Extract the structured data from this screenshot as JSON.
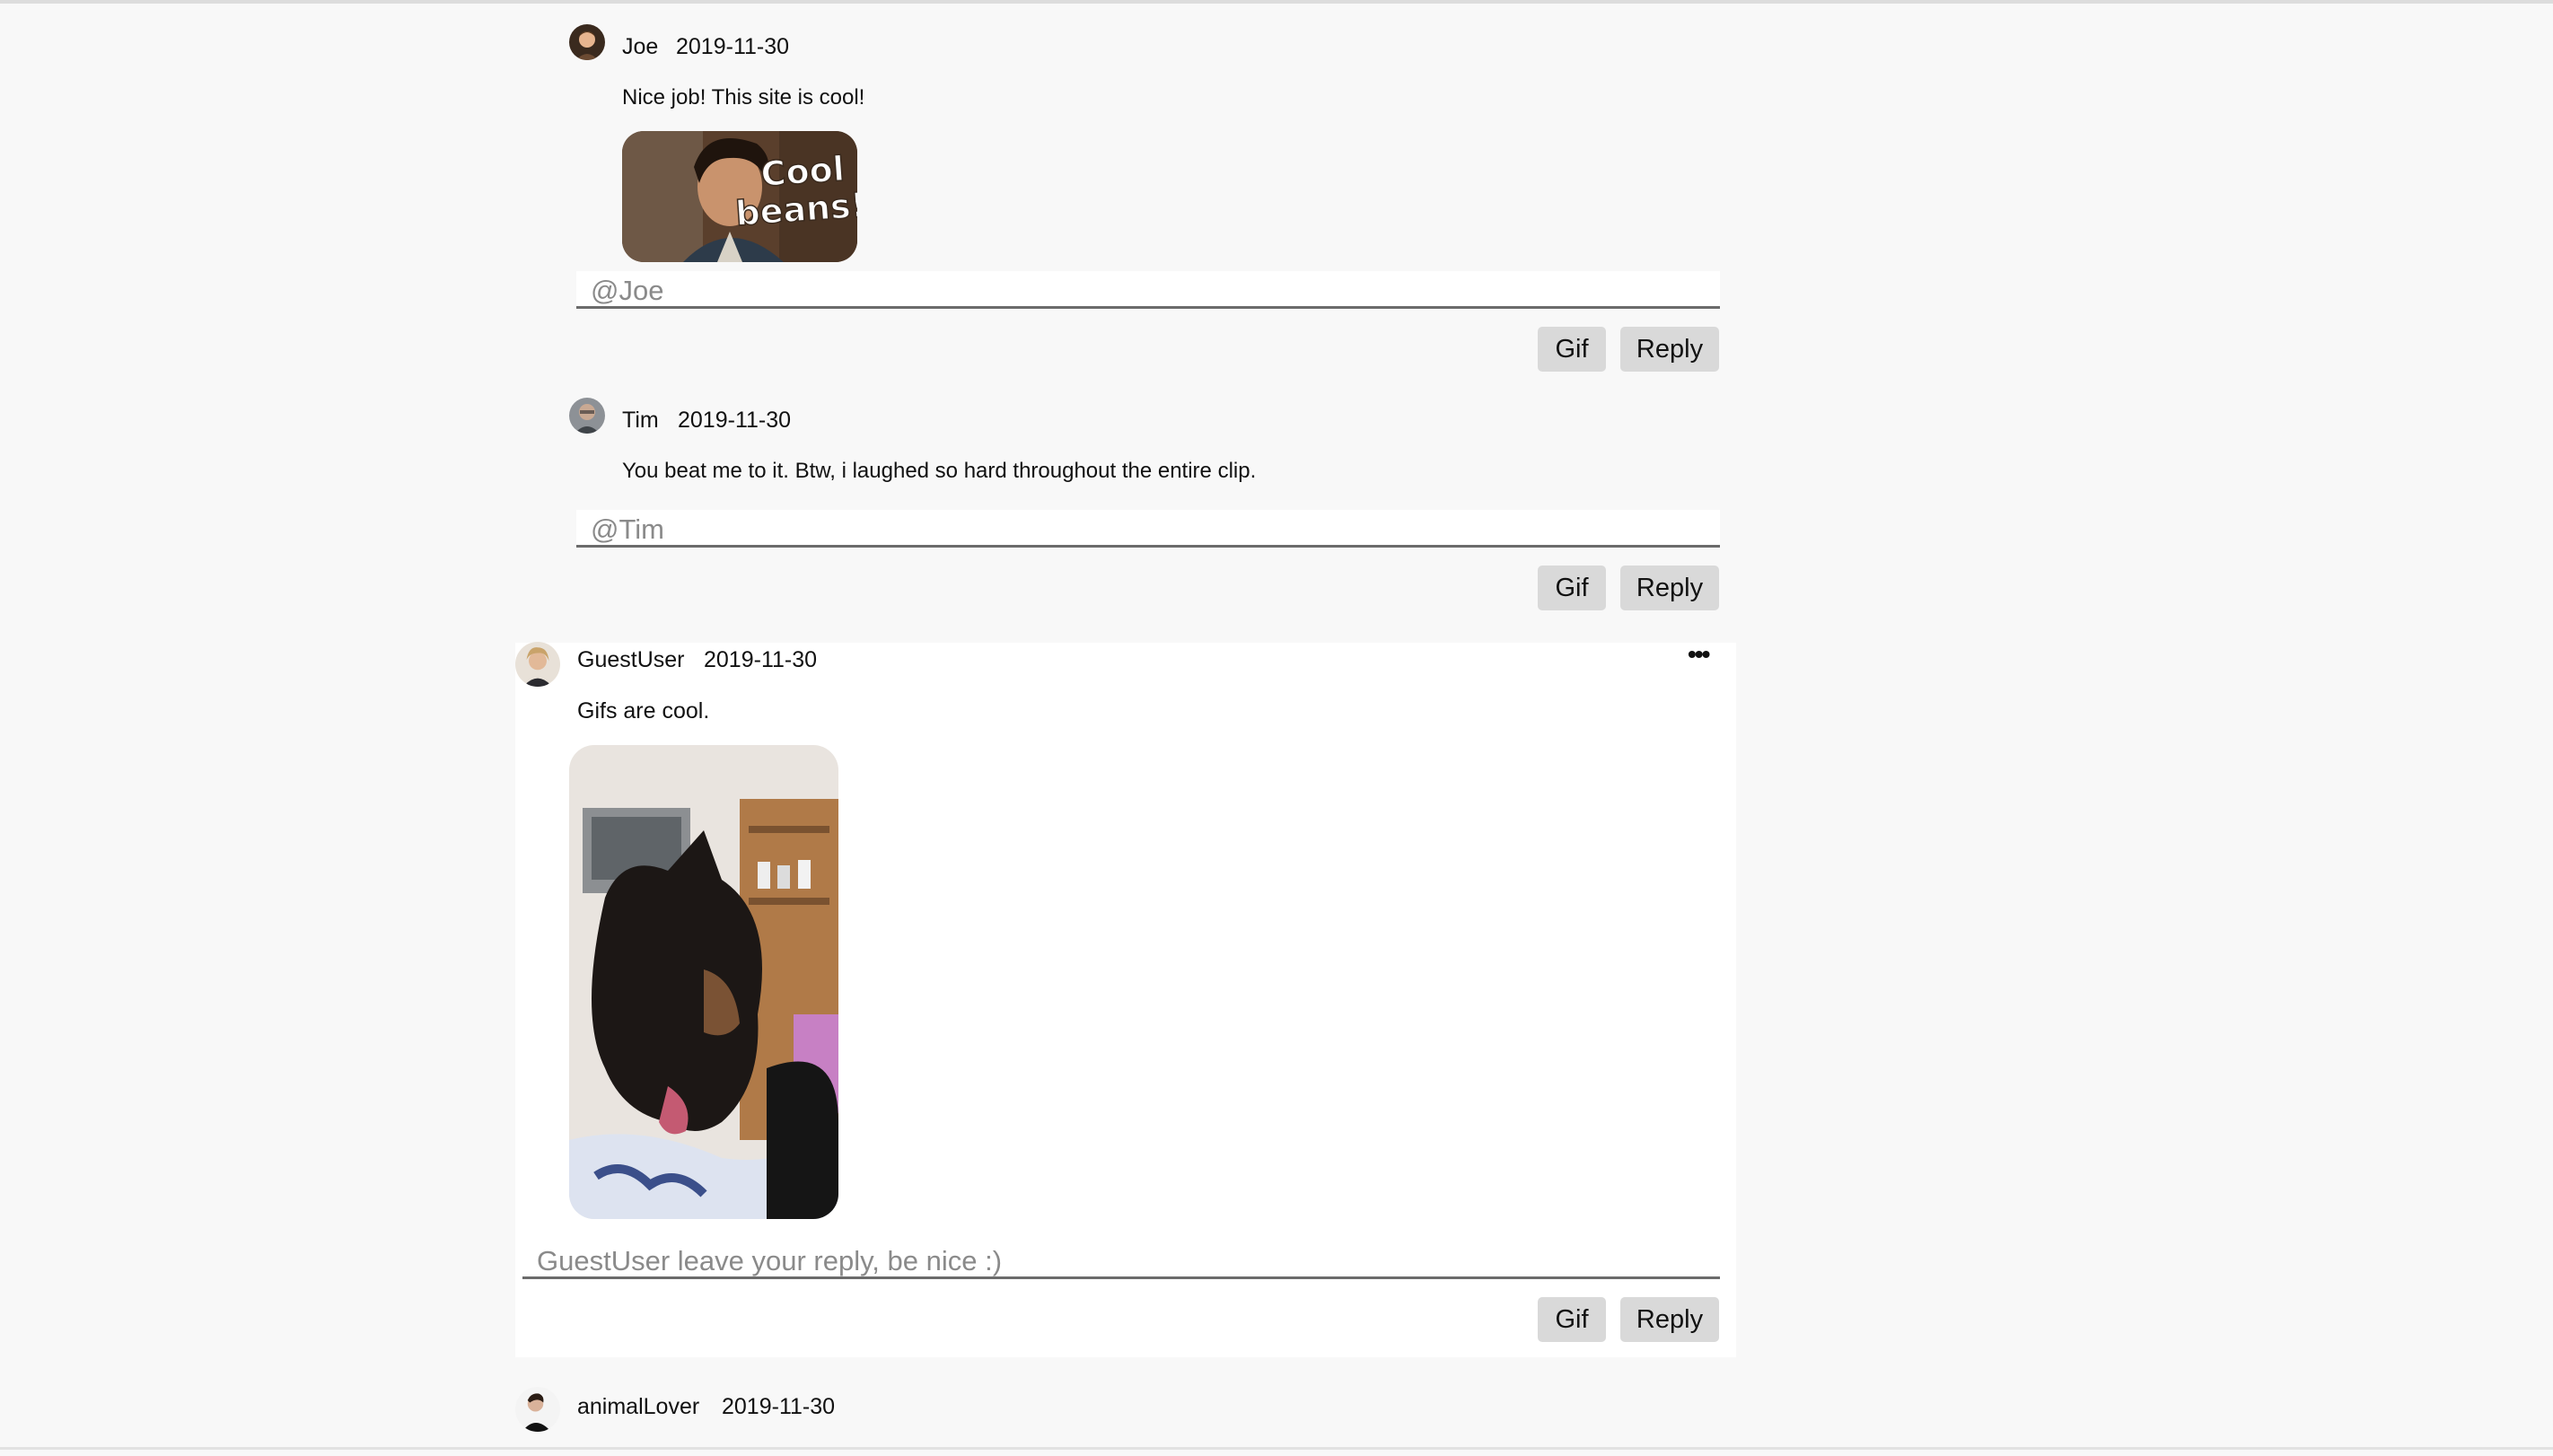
{
  "comments": [
    {
      "author": "Joe",
      "date": "2019-11-30",
      "text": "Nice job! This site is cool!",
      "gif_caption": "Cool beans!",
      "reply_placeholder": "@Joe"
    },
    {
      "author": "Tim",
      "date": "2019-11-30",
      "text": "You beat me to it. Btw, i laughed so hard throughout the entire clip.",
      "reply_placeholder": "@Tim"
    },
    {
      "author": "GuestUser",
      "date": "2019-11-30",
      "text": "Gifs are cool.",
      "more_icon": "•••",
      "reply_placeholder": "GuestUser leave your reply, be nice :)"
    },
    {
      "author": "animalLover",
      "date": "2019-11-30"
    }
  ],
  "buttons": {
    "gif_label": "Gif",
    "reply_label": "Reply"
  },
  "icons": [
    "avatar",
    "more-options-icon",
    "gif-image"
  ]
}
